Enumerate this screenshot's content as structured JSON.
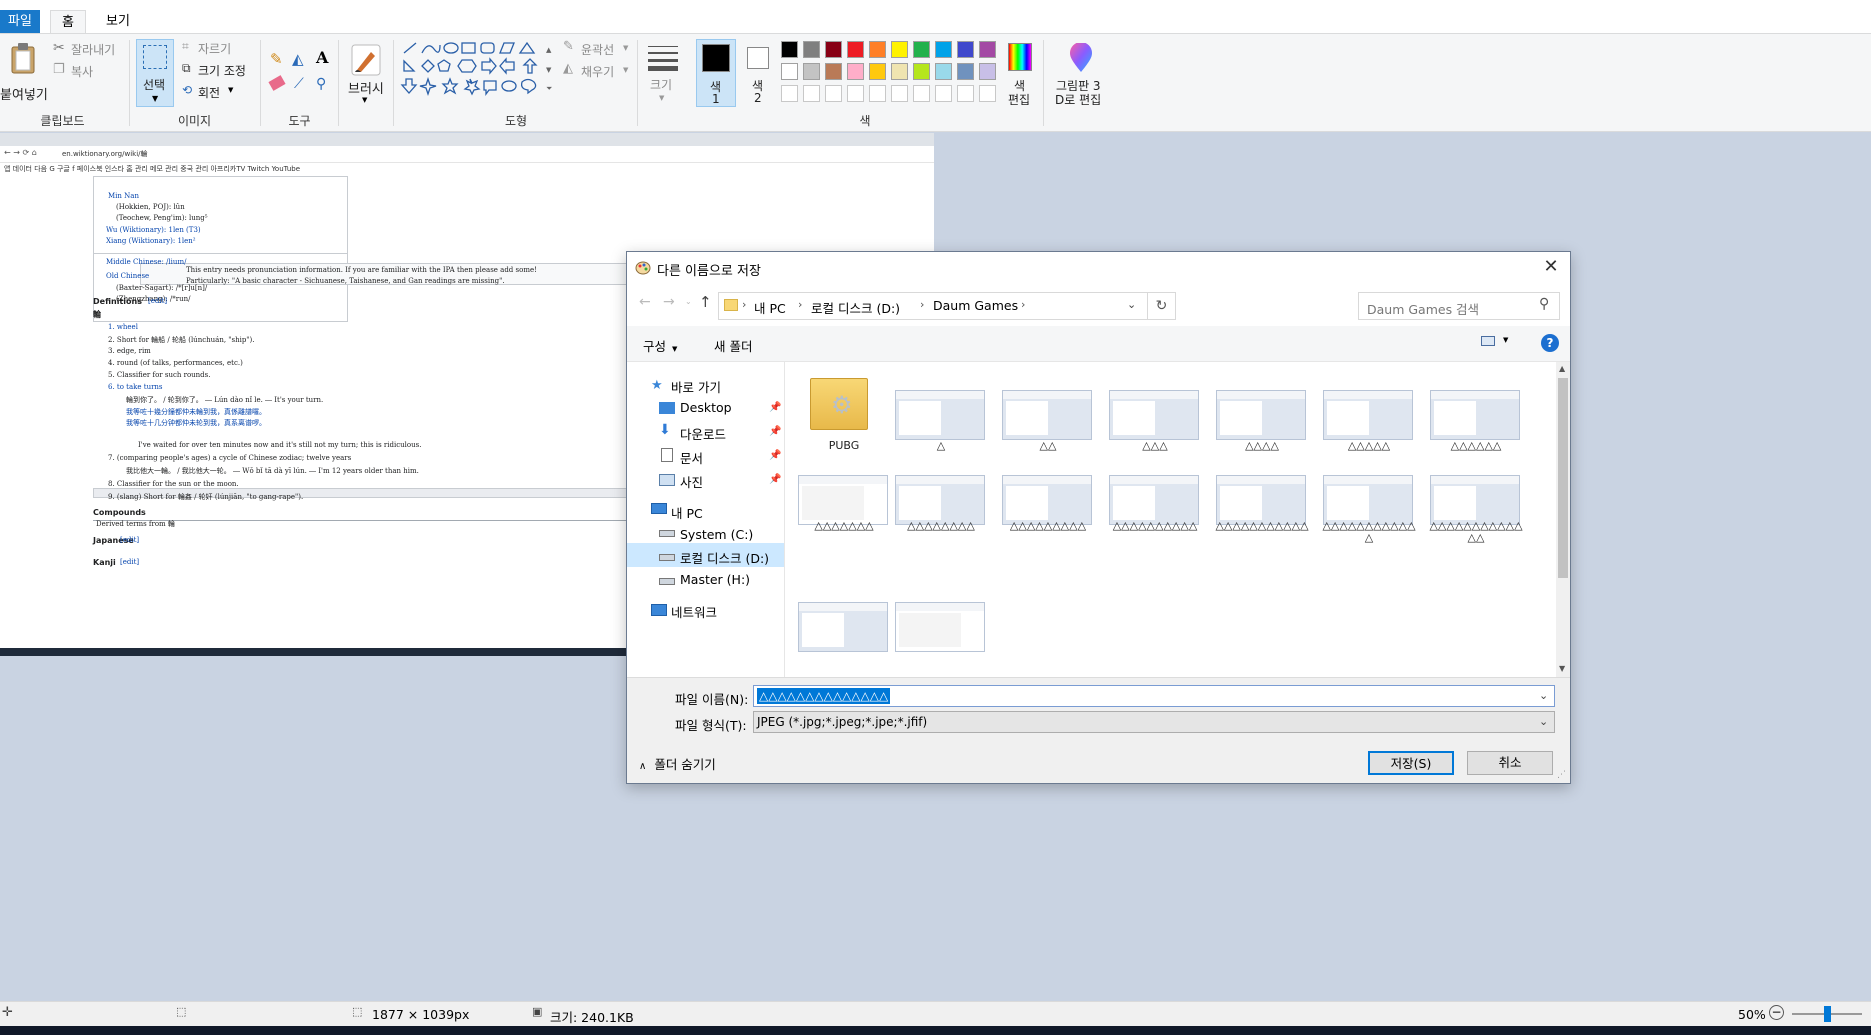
{
  "ribbon": {
    "menu": {
      "file": "파일",
      "home": "홈",
      "view": "보기"
    },
    "clipboard": {
      "paste": "붙여넣기",
      "cut": "잘라내기",
      "copy": "복사",
      "group": "클립보드"
    },
    "image": {
      "select": "선택",
      "crop": "자르기",
      "resize": "크기 조정",
      "rotate": "회전",
      "group": "이미지"
    },
    "tools": {
      "group": "도구"
    },
    "brush": {
      "label": "브러시"
    },
    "shapes": {
      "outline": "윤곽선",
      "fill": "채우기",
      "group": "도형"
    },
    "size": {
      "label": "크기"
    },
    "colors": {
      "color1": "색\n1",
      "color1_a": "색",
      "color1_b": "1",
      "color2_a": "색",
      "color2_b": "2",
      "edit_a": "색",
      "edit_b": "편집",
      "group": "색",
      "palette_row1": [
        "#000000",
        "#7f7f7f",
        "#880015",
        "#ed1c24",
        "#ff7f27",
        "#fff200",
        "#22b14c",
        "#00a2e8",
        "#3f48cc",
        "#a349a4"
      ],
      "palette_row2": [
        "#ffffff",
        "#c3c3c3",
        "#b97a57",
        "#ffaec9",
        "#ffc90e",
        "#efe4b0",
        "#b5e61d",
        "#99d9ea",
        "#7092be",
        "#c8bfe7"
      ]
    },
    "paint3d": {
      "line1": "그림판 3",
      "line2": "D로 편집"
    }
  },
  "background": {
    "url": "en.wiktionary.org/wiki/輪",
    "bookmarks": "앱   데이터   다음   G 구글   f 페이스북   인스타   홈 관리   메모 관리   중국 관리   아프리카TV   Twitch   YouTube",
    "lines": [
      "Min Nan",
      "(Hokkien, POJ): lûn",
      "(Teochew, Peng'im): lung⁵",
      "Wu (Wiktionary): 1len (T3)",
      "Xiang (Wiktionary): 1len²",
      "Middle Chinese: /liuɪn/",
      "Old Chinese",
      "(Baxter-Sagart): /*[r]u[n]/",
      "(Zhengzhang): /*run/",
      "This entry needs pronunciation information. If you are familiar with the IPA then please add some!",
      "Particularly: \"A basic character - Sichuanese, Taishanese, and Gan readings are missing\".",
      "Definitions",
      "輪",
      "1. wheel",
      "2. Short for 輪船 / 轮船 (lúnchuán, \"ship\").",
      "3. edge, rim",
      "4. round (of talks, performances, etc.)",
      "5. Classifier for such rounds.",
      "6. to take turns",
      "輪到你了。 / 轮到你了。 ― Lún dào nǐ le. ― It's your turn.",
      "我等咗十幾分鐘都仲未輪到我，真係離譜囉。",
      "我等咗十几分钟都仲未轮到我，真系离谱啰。",
      "I've waited for over ten minutes now and it's still not my turn; this is ridiculous.",
      "7. (comparing people's ages) a cycle of Chinese zodiac; twelve years",
      "我比他大一輪。 / 我比他大一轮。 ― Wǒ bǐ tā dà yī lún. ― I'm 12 years older than him.",
      "8. Classifier for the sun or the moon.",
      "9. (slang) Short for 輪姦 / 轮奸 (lúnjiān, \"to gang-rape\").",
      "Compounds",
      "Derived terms from 輪",
      "Japanese",
      "Kanji"
    ],
    "edit": "[edit]"
  },
  "dialog": {
    "title": "다른 이름으로 저장",
    "breadcrumb": [
      "내 PC",
      "로컬 디스크 (D:)",
      "Daum Games"
    ],
    "search_placeholder": "Daum Games 검색",
    "toolbar": {
      "organize": "구성",
      "new_folder": "새 폴더"
    },
    "nav": {
      "quick_access": "바로 가기",
      "desktop": "Desktop",
      "downloads": "다운로드",
      "documents": "문서",
      "pictures": "사진",
      "this_pc": "내 PC",
      "system_c": "System (C:)",
      "local_d": "로컬 디스크 (D:)",
      "master_h": "Master (H:)",
      "network": "네트워크"
    },
    "files": [
      "PUBG",
      "△",
      "△△",
      "△△△",
      "△△△△",
      "△△△△△",
      "△△△△△△",
      "△△△△△△△",
      "△△△△△△△△",
      "△△△△△△△△△",
      "△△△△△△△△△△",
      "△△△△△△△△△△△",
      "△△△△△△△△△△△△",
      "△△△△△△△△△△△△△",
      "",
      ""
    ],
    "filename_label": "파일 이름(N):",
    "filename_value": "△△△△△△△△△△△△△△",
    "filetype_label": "파일 형식(T):",
    "filetype_value": "JPEG (*.jpg;*.jpeg;*.jpe;*.jfif)",
    "hide_folders": "폴더 숨기기",
    "save": "저장(S)",
    "cancel": "취소"
  },
  "status": {
    "dimensions": "1877 × 1039px",
    "size": "크기: 240.1KB",
    "zoom": "50%",
    "zoom_level": 0.5
  }
}
